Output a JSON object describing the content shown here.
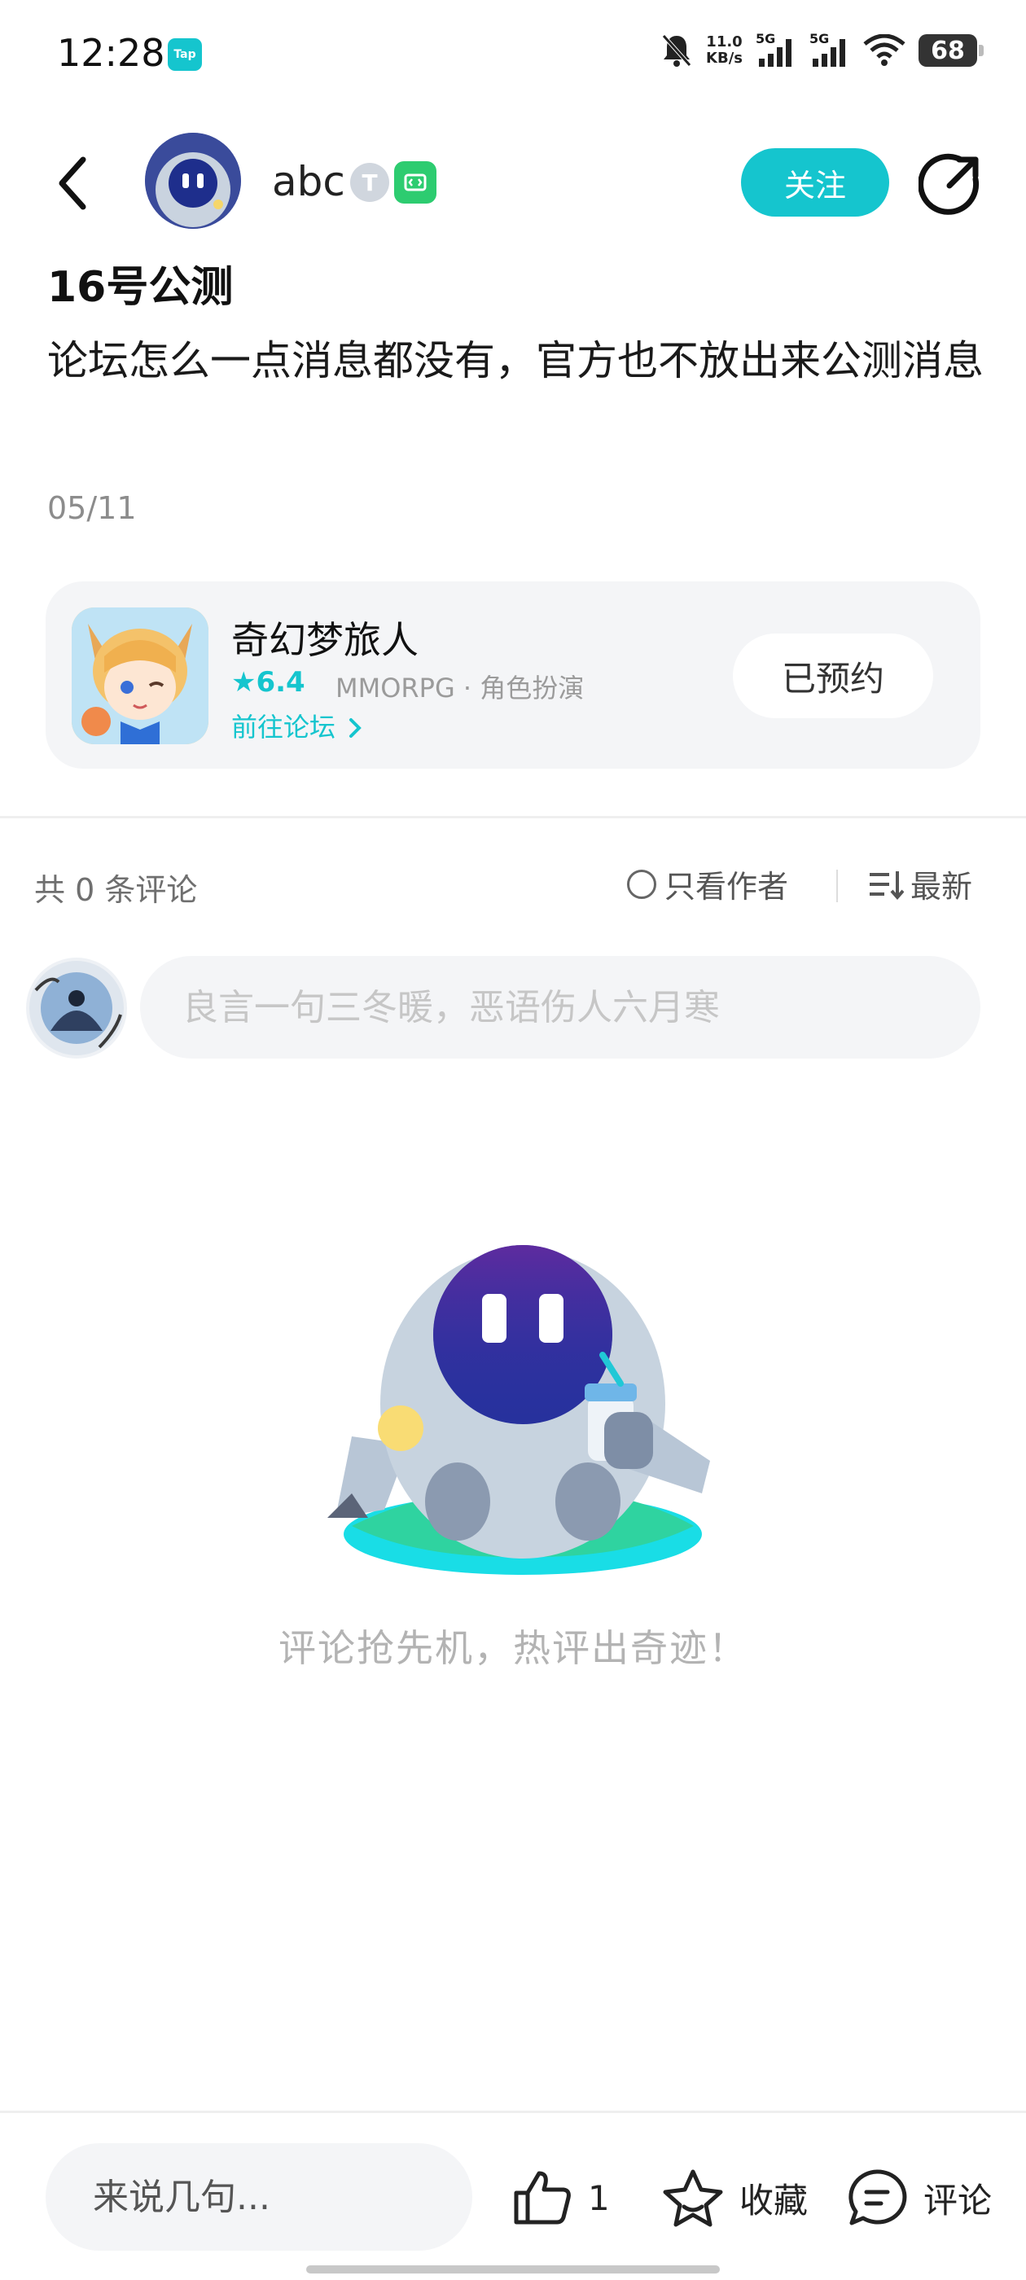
{
  "status_bar": {
    "time": "12:28",
    "app_badge": "Tap",
    "net_speed_value": "11.0",
    "net_speed_unit": "KB/s",
    "signal_1": "5G",
    "signal_2": "5G",
    "battery": "68",
    "icons": [
      "mute-bell-icon",
      "signal-icon",
      "signal-icon",
      "wifi-icon",
      "battery-icon"
    ]
  },
  "header": {
    "username": "abc",
    "level_badge": "T",
    "follow_label": "关注",
    "icons": [
      "back-arrow-icon",
      "developer-badge-icon",
      "share-icon"
    ]
  },
  "post": {
    "title": "16号公测",
    "body": "论坛怎么一点消息都没有，官方也不放出来公测消息",
    "date": "05/11"
  },
  "game_card": {
    "name": "奇幻梦旅人",
    "rating": "6.4",
    "tags": "MMORPG · 角色扮演",
    "forum_link": "前往论坛",
    "reserve_label": "已预约",
    "accent": "#15c5ce"
  },
  "comments": {
    "count_label": "共 0 条评论",
    "only_author_label": "只看作者",
    "sort_label": "最新",
    "input_placeholder": "良言一句三冬暖，恶语伤人六月寒",
    "empty_text": "评论抢先机，热评出奇迹！"
  },
  "bottom_bar": {
    "input_placeholder": "来说几句...",
    "like_count": "1",
    "favorite_label": "收藏",
    "comment_label": "评论",
    "icons": [
      "thumbs-up-icon",
      "star-icon",
      "comment-bubble-icon"
    ]
  }
}
